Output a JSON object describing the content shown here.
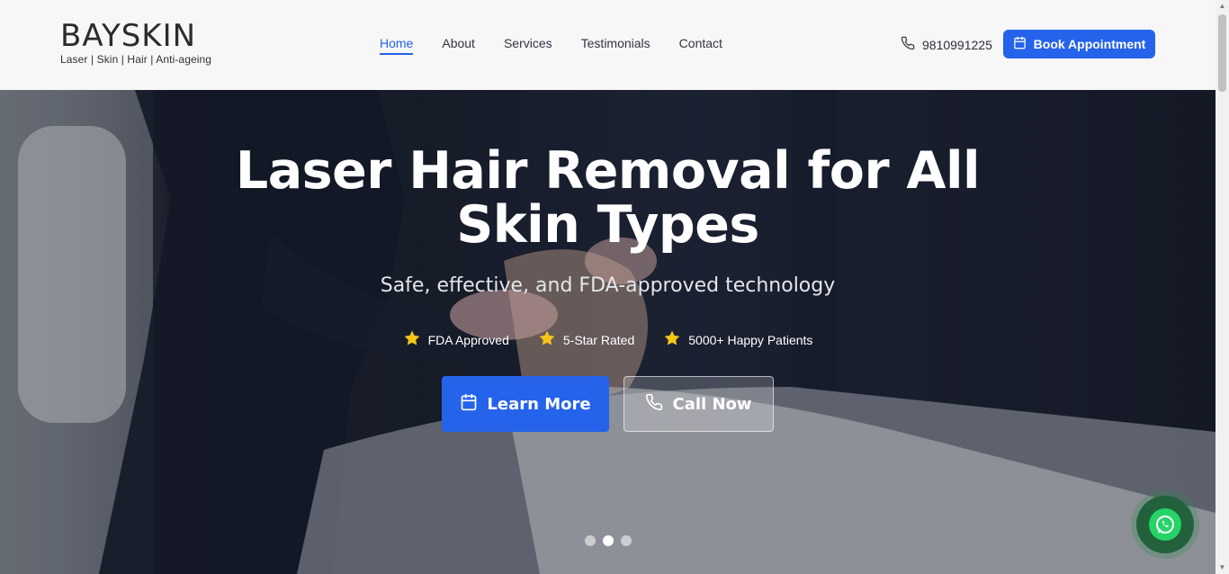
{
  "brand": {
    "name": "BAYSKIN",
    "tagline": "Laser | Skin | Hair | Anti-ageing"
  },
  "nav": {
    "items": [
      {
        "label": "Home",
        "active": true
      },
      {
        "label": "About"
      },
      {
        "label": "Services"
      },
      {
        "label": "Testimonials"
      },
      {
        "label": "Contact"
      }
    ]
  },
  "header": {
    "phone": "9810991225",
    "phone_icon": "phone-icon",
    "book_label": "Book Appointment",
    "book_icon": "calendar-icon"
  },
  "hero": {
    "title_line1": "Laser Hair Removal for All",
    "title_line2": "Skin Types",
    "subtitle": "Safe, effective, and FDA-approved technology",
    "badges": [
      {
        "label": "FDA Approved",
        "icon": "star-icon"
      },
      {
        "label": "5-Star Rated",
        "icon": "star-icon"
      },
      {
        "label": "5000+ Happy Patients",
        "icon": "star-icon"
      }
    ],
    "primary_cta": "Learn More",
    "secondary_cta": "Call Now",
    "slides_total": 3,
    "active_slide": 2
  },
  "colors": {
    "accent": "#2563eb",
    "star": "#f5c518",
    "whatsapp": "#25d366"
  }
}
